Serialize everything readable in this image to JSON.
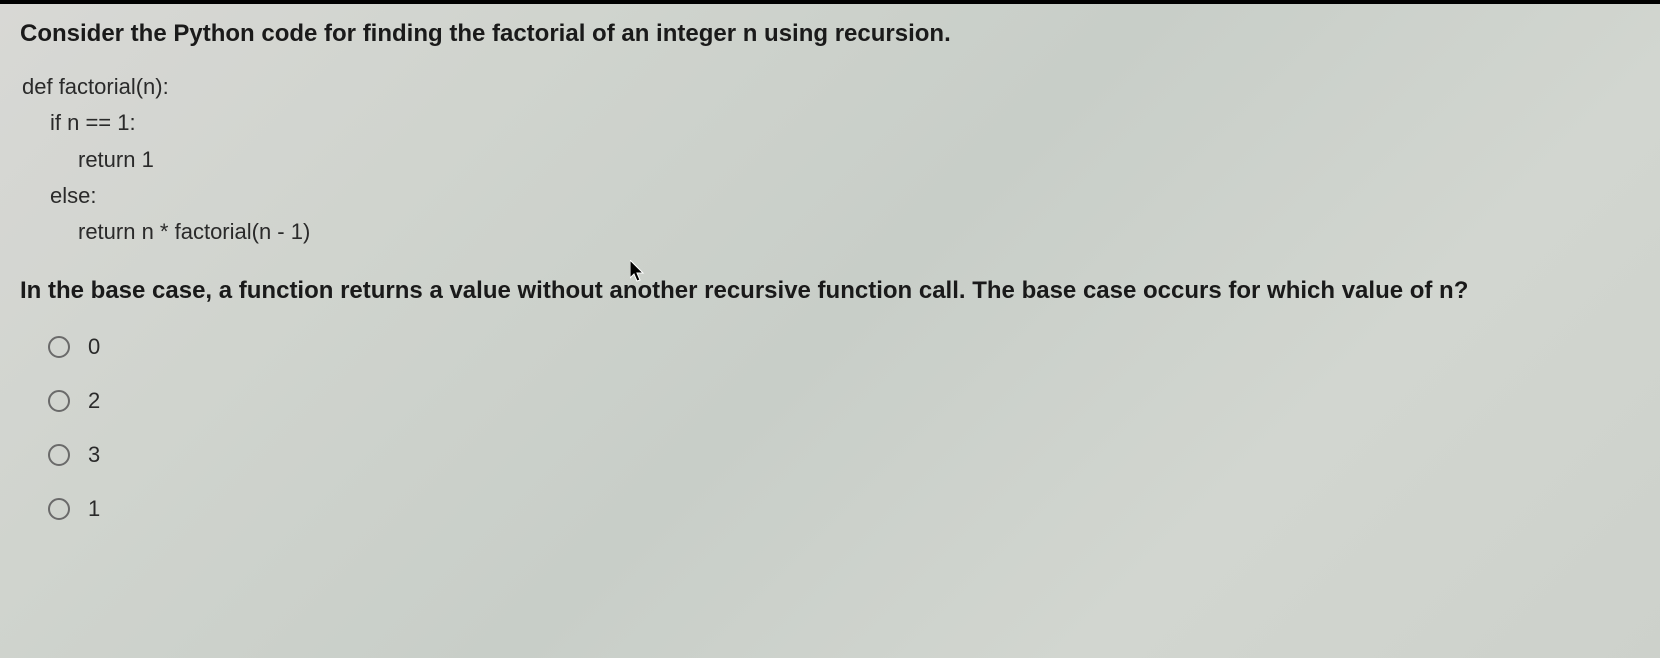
{
  "question": {
    "title": "Consider the Python code for finding the factorial of an integer n using recursion.",
    "code": {
      "line1": "def factorial(n):",
      "line2": "if n == 1:",
      "line3": "return 1",
      "line4": "else:",
      "line5": "return n * factorial(n - 1)"
    },
    "sub": "In the base case, a function returns a value without another recursive function call. The base case occurs for which value of n?"
  },
  "options": [
    {
      "label": "0"
    },
    {
      "label": "2"
    },
    {
      "label": "3"
    },
    {
      "label": "1"
    }
  ]
}
